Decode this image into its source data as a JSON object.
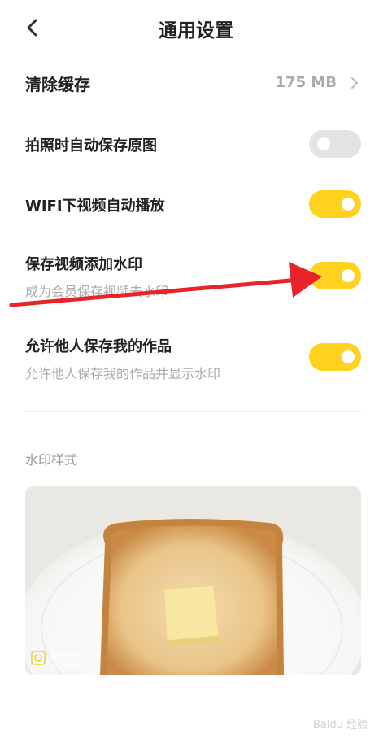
{
  "header": {
    "title": "通用设置"
  },
  "cache": {
    "label": "清除缓存",
    "value": "175 MB"
  },
  "settings": [
    {
      "title": "拍照时自动保存原图",
      "subtitle": "",
      "enabled": false
    },
    {
      "title": "WIFI下视频自动播放",
      "subtitle": "",
      "enabled": true
    },
    {
      "title": "保存视频添加水印",
      "subtitle": "成为会员保存视频去水印",
      "enabled": true
    },
    {
      "title": "允许他人保存我的作品",
      "subtitle": "允许他人保存我的作品并显示水印",
      "enabled": true
    }
  ],
  "watermark_section": {
    "label": "水印样式",
    "stamp_line1": "黄油相机",
    "stamp_line2": "记录好生活"
  },
  "annotation_color": "#e8232a",
  "accent_color": "#ffd21f",
  "footer_watermark": "Baidu 经验"
}
